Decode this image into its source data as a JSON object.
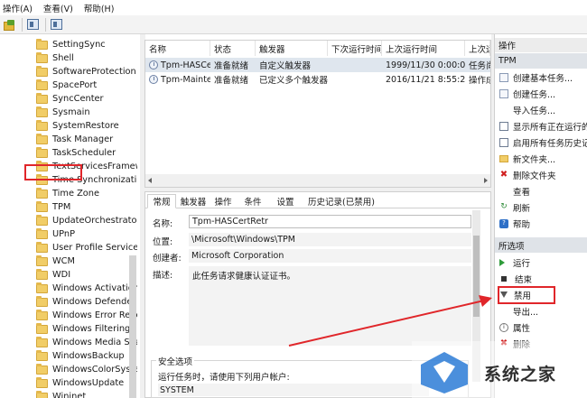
{
  "menu": [
    "操作(A)",
    "查看(V)",
    "帮助(H)"
  ],
  "toolbar": {
    "icons": [
      "back-icon",
      "properties-icon",
      "panel-icon"
    ]
  },
  "tree": {
    "items": [
      "SettingSync",
      "Shell",
      "SoftwareProtection",
      "SpacePort",
      "SyncCenter",
      "Sysmain",
      "SystemRestore",
      "Task Manager",
      "TaskScheduler",
      "TextServicesFramework",
      "Time Synchronization",
      "Time Zone",
      "TPM",
      "UpdateOrchestrator",
      "UPnP",
      "User Profile Service",
      "WCM",
      "WDI",
      "Windows Activation",
      "Windows Defender",
      "Windows Error Reporting",
      "Windows Filtering",
      "Windows Media Sharing",
      "WindowsBackup",
      "WindowsColorSystem",
      "WindowsUpdate",
      "Wininet"
    ],
    "selected": "TPM"
  },
  "tasklist": {
    "columns": [
      "名称",
      "状态",
      "触发器",
      "下次运行时间",
      "上次运行时间",
      "上次运行结果"
    ],
    "rows": [
      {
        "name": "Tpm-HASCertRetr",
        "status": "准备就绪",
        "trigger": "自定义触发器",
        "next": "",
        "last": "1999/11/30 0:00:00",
        "result": "任务尚未运行"
      },
      {
        "name": "Tpm-Maintenance",
        "status": "准备就绪",
        "trigger": "已定义多个触发器",
        "next": "",
        "last": "2016/11/21 8:55:27",
        "result": "操作成功完成"
      }
    ]
  },
  "details": {
    "tabs": [
      "常规",
      "触发器",
      "操作",
      "条件",
      "设置",
      "历史记录(已禁用)"
    ],
    "name_label": "名称:",
    "name_value": "Tpm-HASCertRetr",
    "location_label": "位置:",
    "location_value": "\\Microsoft\\Windows\\TPM",
    "author_label": "创建者:",
    "author_value": "Microsoft Corporation",
    "desc_label": "描述:",
    "desc_value": "此任务请求健康认证证书。",
    "security_title": "安全选项",
    "security_line": "运行任务时，请使用下列用户帐户:",
    "security_user": "SYSTEM"
  },
  "actions": {
    "header": "操作",
    "section1": "TPM",
    "items1": [
      {
        "label": "创建基本任务...",
        "icon": "create-basic-task-icon"
      },
      {
        "label": "创建任务...",
        "icon": "create-task-icon"
      },
      {
        "label": "导入任务...",
        "icon": ""
      },
      {
        "label": "显示所有正在运行的任务",
        "icon": "running-tasks-icon"
      },
      {
        "label": "启用所有任务历史记录",
        "icon": "history-icon"
      },
      {
        "label": "新文件夹...",
        "icon": "folder-icon"
      },
      {
        "label": "删除文件夹",
        "icon": "delete-icon"
      },
      {
        "label": "查看",
        "icon": ""
      },
      {
        "label": "刷新",
        "icon": "refresh-icon"
      },
      {
        "label": "帮助",
        "icon": "help-icon"
      }
    ],
    "section2": "所选项",
    "items2": [
      {
        "label": "运行",
        "icon": "run-icon"
      },
      {
        "label": "结束",
        "icon": "end-icon"
      },
      {
        "label": "禁用",
        "icon": "disable-icon"
      },
      {
        "label": "导出...",
        "icon": ""
      },
      {
        "label": "属性",
        "icon": "properties-icon"
      },
      {
        "label": "删除",
        "icon": "delete-icon"
      }
    ]
  },
  "watermark": {
    "text": "系统之家"
  }
}
